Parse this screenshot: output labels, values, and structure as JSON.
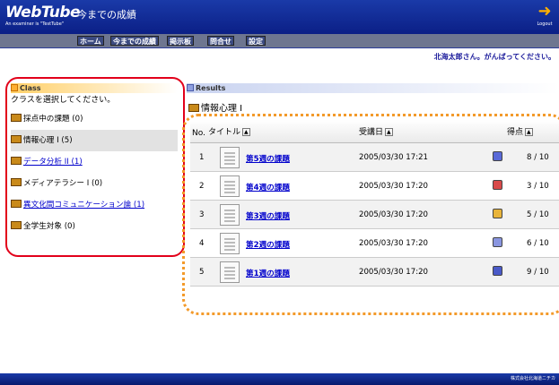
{
  "header": {
    "logo": "WebTube",
    "logo_sub": "An examiner is \"TestTube\"",
    "page_title": "今までの成績",
    "logout_label": "Logout"
  },
  "nav": [
    "ホーム",
    "今までの成績",
    "掲示板",
    "問合せ",
    "設定"
  ],
  "greeting": "北海太郎さん。がんばってください。",
  "class_panel": {
    "heading": "Class",
    "prompt": "クラスを選択してください。",
    "items": [
      {
        "label": "採点中の課題 (0)",
        "link": false,
        "active": false
      },
      {
        "label": "情報心理 I (5)",
        "link": false,
        "active": true
      },
      {
        "label": "データ分析 II (1)",
        "link": true,
        "active": false
      },
      {
        "label": "メディアテラシー I (0)",
        "link": false,
        "active": false
      },
      {
        "label": "異文化間コミュニケーション論 (1)",
        "link": true,
        "active": false
      },
      {
        "label": "全学生対象 (0)",
        "link": false,
        "active": false
      }
    ]
  },
  "results": {
    "heading": "Results",
    "class_title": "情報心理 I",
    "columns": {
      "no": "No.",
      "title": "タイトル",
      "date": "受講日",
      "score": "得点"
    },
    "rows": [
      {
        "no": "1",
        "title": "第5週の課題",
        "date": "2005/03/30 17:21",
        "score": "8 / 10",
        "face": "#5a6ad8"
      },
      {
        "no": "2",
        "title": "第4週の課題",
        "date": "2005/03/30 17:20",
        "score": "3 / 10",
        "face": "#d84a4a"
      },
      {
        "no": "3",
        "title": "第3週の課題",
        "date": "2005/03/30 17:20",
        "score": "5 / 10",
        "face": "#e8b43a"
      },
      {
        "no": "4",
        "title": "第2週の課題",
        "date": "2005/03/30 17:20",
        "score": "6 / 10",
        "face": "#8a96e0"
      },
      {
        "no": "5",
        "title": "第1週の課題",
        "date": "2005/03/30 17:20",
        "score": "9 / 10",
        "face": "#4a5ac8"
      }
    ]
  },
  "footer": {
    "brand": "株式会社北海道ニチカ"
  },
  "colors": {
    "header_blue": "#1a3aa8",
    "link": "#0000cc",
    "red_outline": "#e2001a",
    "orange_outline": "#f39a2a"
  }
}
